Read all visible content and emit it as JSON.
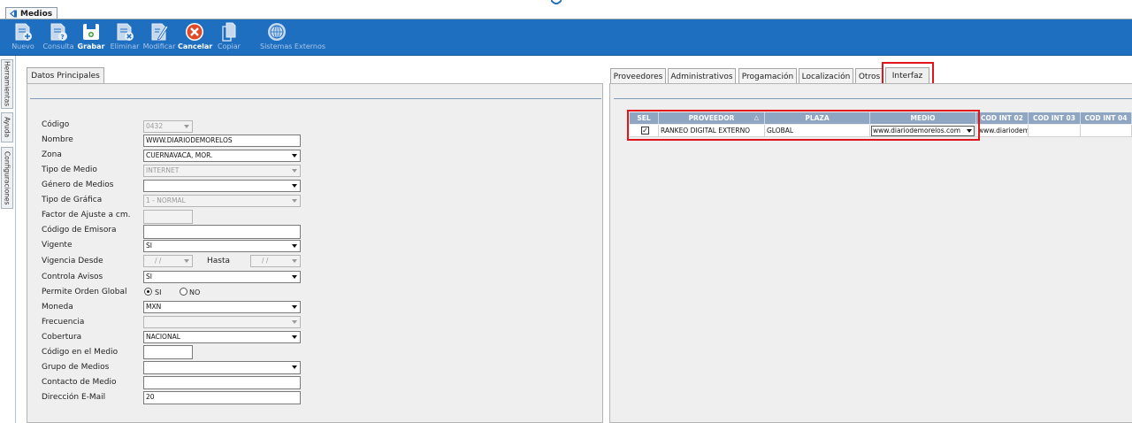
{
  "window": {
    "tab_label": "Medios"
  },
  "toolbar": {
    "buttons": [
      {
        "label": "Nuevo",
        "icon": "new-doc-icon",
        "enabled": false
      },
      {
        "label": "Consulta",
        "icon": "query-doc-icon",
        "enabled": false
      },
      {
        "label": "Grabar",
        "icon": "save-icon",
        "enabled": true
      },
      {
        "label": "Eliminar",
        "icon": "delete-doc-icon",
        "enabled": false
      },
      {
        "label": "Modificar",
        "icon": "edit-doc-icon",
        "enabled": false
      },
      {
        "label": "Cancelar",
        "icon": "cancel-icon",
        "enabled": true
      },
      {
        "label": "Copiar",
        "icon": "copy-icon",
        "enabled": false
      },
      {
        "label": "Sistemas Externos",
        "icon": "external-systems-icon",
        "enabled": false
      }
    ]
  },
  "side_tabs": [
    "Herramientas",
    "Ayuda",
    "Configuraciones"
  ],
  "left_panel": {
    "tab": "Datos Principales",
    "fields": {
      "codigo": {
        "label": "Código",
        "value": "0432"
      },
      "nombre": {
        "label": "Nombre",
        "value": "WWW.DIARIODEMORELOS"
      },
      "zona": {
        "label": "Zona",
        "value": "CUERNAVACA, MOR."
      },
      "tipo_medio": {
        "label": "Tipo de Medio",
        "value": "INTERNET"
      },
      "genero_medios": {
        "label": "Género de Medios",
        "value": ""
      },
      "tipo_grafica": {
        "label": "Tipo de Gráfica",
        "value": "1 - NORMAL"
      },
      "factor_ajuste": {
        "label": "Factor de Ajuste a cm.",
        "value": ""
      },
      "codigo_emisora": {
        "label": "Código de Emisora",
        "value": ""
      },
      "vigente": {
        "label": "Vigente",
        "value": "SI"
      },
      "vigencia_desde": {
        "label": "Vigencia Desde",
        "value": "/ /"
      },
      "hasta": {
        "label": "Hasta",
        "value": "/ /"
      },
      "controla_avisos": {
        "label": "Controla Avisos",
        "value": "SI"
      },
      "permite_orden_global": {
        "label": "Permite Orden Global",
        "option_si": "SI",
        "option_no": "NO",
        "selected": "SI"
      },
      "moneda": {
        "label": "Moneda",
        "value": "MXN"
      },
      "frecuencia": {
        "label": "Frecuencia",
        "value": ""
      },
      "cobertura": {
        "label": "Cobertura",
        "value": "NACIONAL"
      },
      "codigo_en_medio": {
        "label": "Código en el Medio",
        "value": ""
      },
      "grupo_medios": {
        "label": "Grupo de Medios",
        "value": ""
      },
      "contacto_medio": {
        "label": "Contacto de Medio",
        "value": ""
      },
      "direccion_email": {
        "label": "Dirección E-Mail",
        "value": "20"
      }
    }
  },
  "right_panel": {
    "tabs": [
      "Proveedores",
      "Administrativos",
      "Progamación",
      "Localización",
      "Otros",
      "Interfaz"
    ],
    "active_tab": "Interfaz",
    "grid": {
      "columns": [
        "SEL",
        "PROVEEDOR",
        "PLAZA",
        "MEDIO",
        "COD INT 02",
        "COD INT 03",
        "COD INT 04"
      ],
      "sort_indicator": "△",
      "rows": [
        {
          "sel": true,
          "proveedor": "RANKEO DIGITAL EXTERNO",
          "plaza": "GLOBAL",
          "medio": "www.diariodemorelos.com",
          "cod_int_02": "www.diariodemo",
          "cod_int_03": "",
          "cod_int_04": ""
        }
      ]
    }
  },
  "colors": {
    "toolbar": "#1f6fc0",
    "highlight": "#e0141a",
    "grid_header": "#8fa6c3"
  }
}
